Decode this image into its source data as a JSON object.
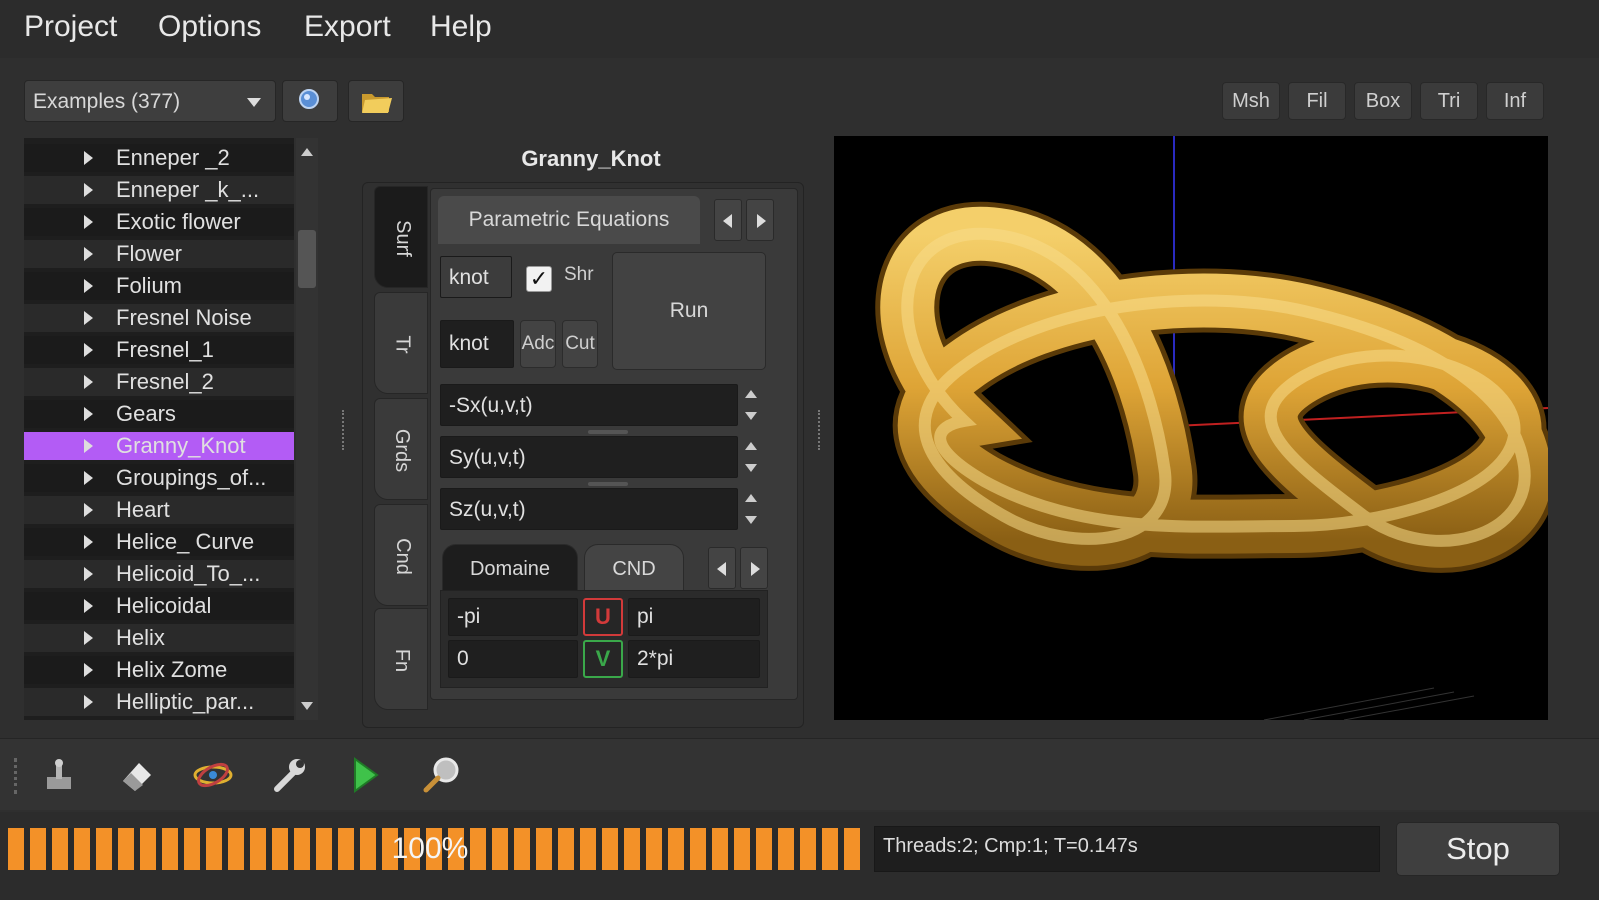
{
  "menubar": {
    "items": [
      "Project",
      "Options",
      "Export",
      "Help"
    ]
  },
  "toolbar": {
    "examples_combo": "Examples (377)",
    "search_icon": "search-icon",
    "open_icon": "folder-open-icon",
    "mode_buttons": [
      "Msh",
      "Fil",
      "Box",
      "Tri",
      "Inf"
    ]
  },
  "examples_list": {
    "items": [
      "Enneper _2",
      "Enneper _k_...",
      "Exotic flower",
      "Flower",
      "Folium",
      "Fresnel Noise",
      "Fresnel_1",
      "Fresnel_2",
      "Gears",
      "Granny_Knot",
      "Groupings_of...",
      "Heart",
      "Helice_ Curve",
      "Helicoid_To_...",
      "Helicoidal",
      "Helix",
      "Helix Zome",
      "Helliptic_par..."
    ],
    "selected": "Granny_Knot",
    "selected_color": "#b35cf5"
  },
  "editor": {
    "title": "Granny_Knot",
    "side_tabs": [
      "Surf",
      "Tr",
      "Grds",
      "Cnd",
      "Fn"
    ],
    "equations_tab": "Parametric Equations",
    "name_field": "knot",
    "show_checkbox_mark": "✓",
    "show_label": "Shr",
    "name_field2": "knot",
    "add_button": "Adc",
    "cut_button": "Cut",
    "run_button": "Run",
    "x_equation": "-Sx(u,v,t)",
    "y_equation": "Sy(u,v,t)",
    "z_equation": "Sz(u,v,t)",
    "bottom_tabs": [
      "Domaine",
      "CND"
    ],
    "u_min": "-pi",
    "u_label": "U",
    "u_max": "pi",
    "v_min": "0",
    "v_label": "V",
    "v_max": "2*pi",
    "u_color": "#d23a3a",
    "v_color": "#3aa84a"
  },
  "viewport": {
    "surface_color": "#e0a93a",
    "background": "#000000"
  },
  "bottom_toolbar": {
    "icons": [
      "robot-arm-icon",
      "eraser-icon",
      "atom-icon",
      "wrench-icon",
      "play-icon",
      "zoom-icon"
    ]
  },
  "status": {
    "progress_text": "100%",
    "progress": 1.0,
    "progress_color": "#f39128",
    "threads_info": "Threads:2; Cmp:1; T=0.147s",
    "stop_button": "Stop"
  }
}
